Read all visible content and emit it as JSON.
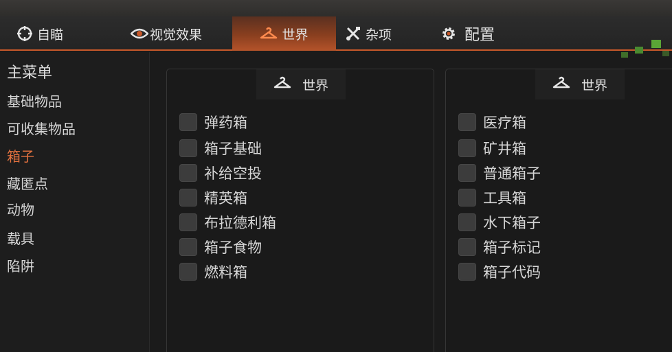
{
  "tabs": [
    {
      "label": "自瞄",
      "icon": "crosshair-icon"
    },
    {
      "label": "视觉效果",
      "icon": "eye-icon"
    },
    {
      "label": "世界",
      "icon": "hanger-icon"
    },
    {
      "label": "杂项",
      "icon": "tools-icon"
    },
    {
      "label": "配置",
      "icon": "gear-icon"
    }
  ],
  "active_tab": "世界",
  "sidebar": {
    "header": "主菜单",
    "items": [
      {
        "label": "基础物品"
      },
      {
        "label": "可收集物品"
      },
      {
        "label": "箱子"
      },
      {
        "label": "藏匿点"
      },
      {
        "label": "动物"
      },
      {
        "label": "载具"
      },
      {
        "label": "陷阱"
      }
    ],
    "active_item": "箱子"
  },
  "panels": [
    {
      "title": "世界",
      "icon": "hanger-icon",
      "options": [
        {
          "label": "弹药箱",
          "checked": false
        },
        {
          "label": "箱子基础",
          "checked": false
        },
        {
          "label": "补给空投",
          "checked": false
        },
        {
          "label": "精英箱",
          "checked": false
        },
        {
          "label": "布拉德利箱",
          "checked": false
        },
        {
          "label": "箱子食物",
          "checked": false
        },
        {
          "label": "燃料箱",
          "checked": false
        }
      ]
    },
    {
      "title": "世界",
      "icon": "hanger-icon",
      "options": [
        {
          "label": "医疗箱",
          "checked": false
        },
        {
          "label": "矿井箱",
          "checked": false
        },
        {
          "label": "普通箱子",
          "checked": false
        },
        {
          "label": "工具箱",
          "checked": false
        },
        {
          "label": "水下箱子",
          "checked": false
        },
        {
          "label": "箱子标记",
          "checked": false
        },
        {
          "label": "箱子代码",
          "checked": false
        }
      ]
    }
  ],
  "colors": {
    "accent": "#e0703e",
    "background": "#1b1b1b",
    "panel": "#1a1a1a",
    "checkbox": "#3c3c3c"
  }
}
